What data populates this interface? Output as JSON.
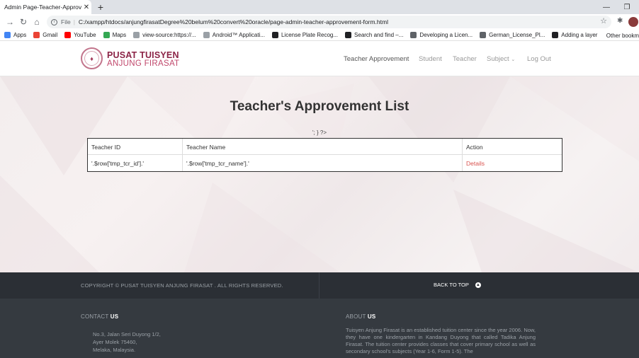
{
  "browser": {
    "tab_title": "Admin Page-Teacher-Approveme",
    "address_scheme": "File",
    "url": "C:/xampp/htdocs/anjungfirasatDegree%20belum%20convert%20oracle/page-admin-teacher-approvement-form.html",
    "bookmarks": [
      {
        "label": "Apps",
        "icon": "apps-icon",
        "color": "#4285f4"
      },
      {
        "label": "Gmail",
        "icon": "gmail-icon",
        "color": "#ea4335"
      },
      {
        "label": "YouTube",
        "icon": "youtube-icon",
        "color": "#ff0000"
      },
      {
        "label": "Maps",
        "icon": "maps-icon",
        "color": "#34a853"
      },
      {
        "label": "view-source:https://...",
        "icon": "globe-icon",
        "color": "#9aa0a6"
      },
      {
        "label": "Android™ Applicati...",
        "icon": "globe-icon",
        "color": "#9aa0a6"
      },
      {
        "label": "License Plate Recog...",
        "icon": "video-icon",
        "color": "#202124"
      },
      {
        "label": "Search and find –...",
        "icon": "video-icon",
        "color": "#202124"
      },
      {
        "label": "Developing a Licen...",
        "icon": "s-icon",
        "color": "#5f6368"
      },
      {
        "label": "German_License_Pl...",
        "icon": "github-icon",
        "color": "#5f6368"
      },
      {
        "label": "Adding a layer - Ho...",
        "icon": "page-icon",
        "color": "#202124"
      }
    ],
    "other_bookmarks": "Other bookm"
  },
  "site": {
    "brand_line1": "PUSAT TUISYEN",
    "brand_line2": "ANJUNG FIRASAT",
    "nav": {
      "teacher_approvement": "Teacher Approvement",
      "student": "Student",
      "teacher": "Teacher",
      "subject": "Subject",
      "logout": "Log Out"
    }
  },
  "main": {
    "title": "Teacher's Approvement List",
    "stray_text": "'; } ?>",
    "table": {
      "headers": [
        "Teacher ID",
        "Teacher Name",
        "Action"
      ],
      "row": {
        "id": "'.$row['tmp_tcr_id'].'",
        "name": "'.$row['tmp_tcr_name'].'",
        "action": "Details"
      }
    }
  },
  "footer": {
    "copyright": "COPYRIGHT © PUSAT TUISYEN ANJUNG FIRASAT . ALL RIGHTS RESERVED.",
    "back_to_top": "BACK TO TOP",
    "contact_prefix": "CONTACT",
    "contact_suffix": "US",
    "address_line1": "No.3, Jalan Seri Duyong 1/2,",
    "address_line2": "Ayer Molek 75460,",
    "address_line3": "Melaka, Malaysia.",
    "about_prefix": "ABOUT",
    "about_suffix": "US",
    "about_text": "Tuisyen Anjung Firasat is an established tuition center since the year 2006. Now, they have one kindergarten in Kandang Duyong that called Tadika Anjung Firasat. The tuition center provides classes that cover primary school as well as secondary school's subjects (Year 1-6, Form 1-5). The"
  },
  "colors": {
    "brand_dark": "#8b2346",
    "brand_light": "#c0476b",
    "link_red": "#d9534f",
    "footer_dark": "#2b2f35",
    "footer_mid": "#353a40"
  }
}
